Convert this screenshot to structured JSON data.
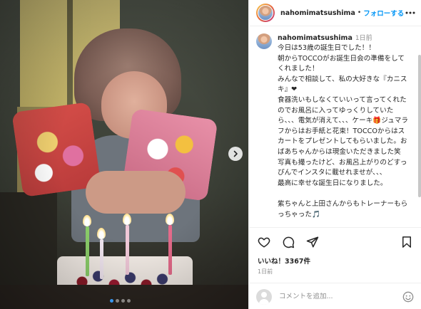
{
  "post": {
    "username": "nahomimatsushima",
    "separator": "•",
    "follow_label": "フォローする",
    "more_icon": "more-horizontal-icon"
  },
  "caption": {
    "username": "nahomimatsushima",
    "time": "1日前",
    "text": "今日は53歳の誕生日でした！！\n朝からTOCCOがお誕生日会の準備をしてくれました！\nみんなで相談して、私の大好きな『カニスキ』❤\n食器洗いもしなくていいって言ってくれたのでお風呂に入ってゆっくりしていたら、、、電気が消えて、、、ケーキ🎁ジュマラフからはお手紙と花束！TOCCOからはスカートをプレゼントしてもらいました。おばあちゃんからは現金いただきました笑\n写真も撮ったけど、お風呂上がりのどすっぴんでインスタに載せれませが、、、\n最高に幸せな誕生日になりました。\n\n紫ちゃんと上田さんからもトレーナーもらっちゃった🎵"
  },
  "actions": {
    "like_icon": "heart-icon",
    "comment_icon": "comment-icon",
    "share_icon": "send-icon",
    "save_icon": "bookmark-icon",
    "likes_label": "いいね！3367件",
    "date": "1日前"
  },
  "comment_box": {
    "placeholder": "コメントを追加...",
    "emoji_icon": "emoji-smile-icon"
  },
  "media": {
    "carousel_total": 4,
    "carousel_active": 1,
    "next_icon": "chevron-right-icon"
  },
  "colors": {
    "link_blue": "#0095f6",
    "text_primary": "#262626",
    "text_secondary": "#8e8e8e",
    "border": "#efefef",
    "heart_red": "#ed4956"
  }
}
